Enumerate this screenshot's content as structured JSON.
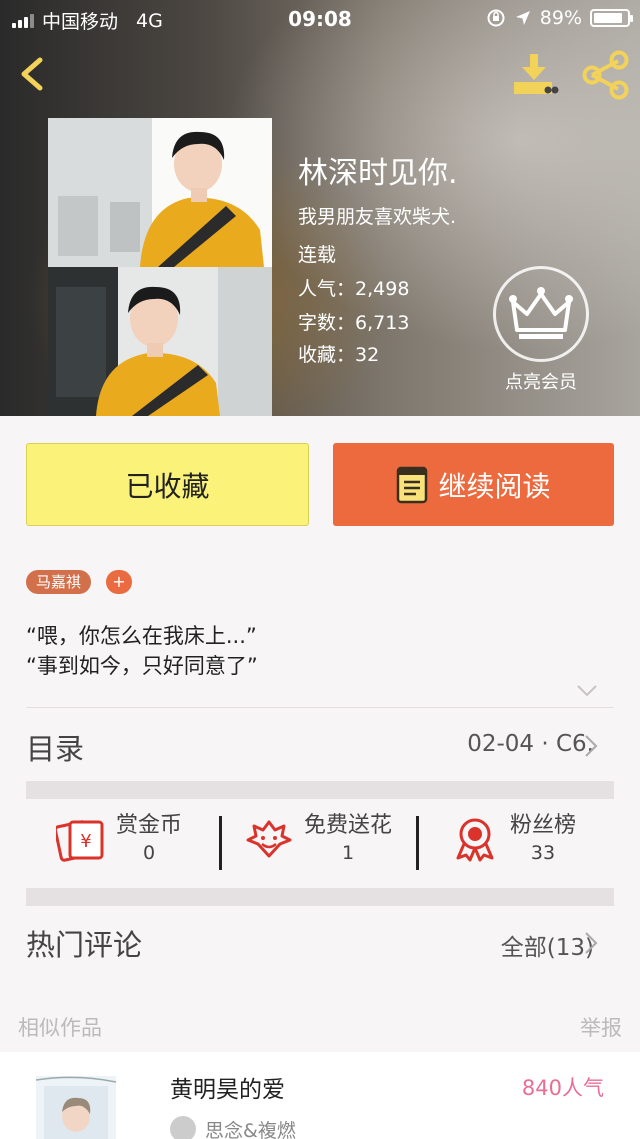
{
  "status_bar": {
    "carrier": "中国移动",
    "network": "4G",
    "time": "09:08",
    "battery": "89%",
    "battery_level": 0.89
  },
  "book": {
    "title": "林深时见你.",
    "author": "我男朋友喜欢柴犬.",
    "status": "连载",
    "stats": [
      {
        "label": "人气：",
        "value": "2,498"
      },
      {
        "label": "字数：",
        "value": "6,713"
      },
      {
        "label": "收藏：",
        "value": "32"
      }
    ],
    "vip_label": "点亮会员"
  },
  "actions": {
    "favorited_label": "已收藏",
    "continue_label": "继续阅读"
  },
  "tags": {
    "items": [
      "马嘉祺"
    ],
    "add_label": "+"
  },
  "intro": {
    "lines": [
      "“喂，你怎么在我床上...”",
      "“事到如今，只好同意了”"
    ]
  },
  "catalog": {
    "title": "目录",
    "latest": "02-04 · C6."
  },
  "rewards": [
    {
      "name": "赏金币",
      "value": "0"
    },
    {
      "name": "免费送花",
      "value": "1"
    },
    {
      "name": "粉丝榜",
      "value": "33"
    }
  ],
  "comments": {
    "title": "热门评论",
    "all_label": "全部(13)"
  },
  "similar": {
    "heading": "相似作品",
    "report_label": "举报",
    "item": {
      "title": "黄明昊的爱",
      "popularity": "840人气",
      "author": "思念&複燃"
    }
  },
  "colors": {
    "fav_bg": "#fbf27a",
    "read_bg": "#ec6a3d",
    "tag_bg": "#d2704b",
    "icon_red": "#d9332c",
    "popularity": "#e96e95",
    "toolbar_icon": "#f3d25a"
  }
}
